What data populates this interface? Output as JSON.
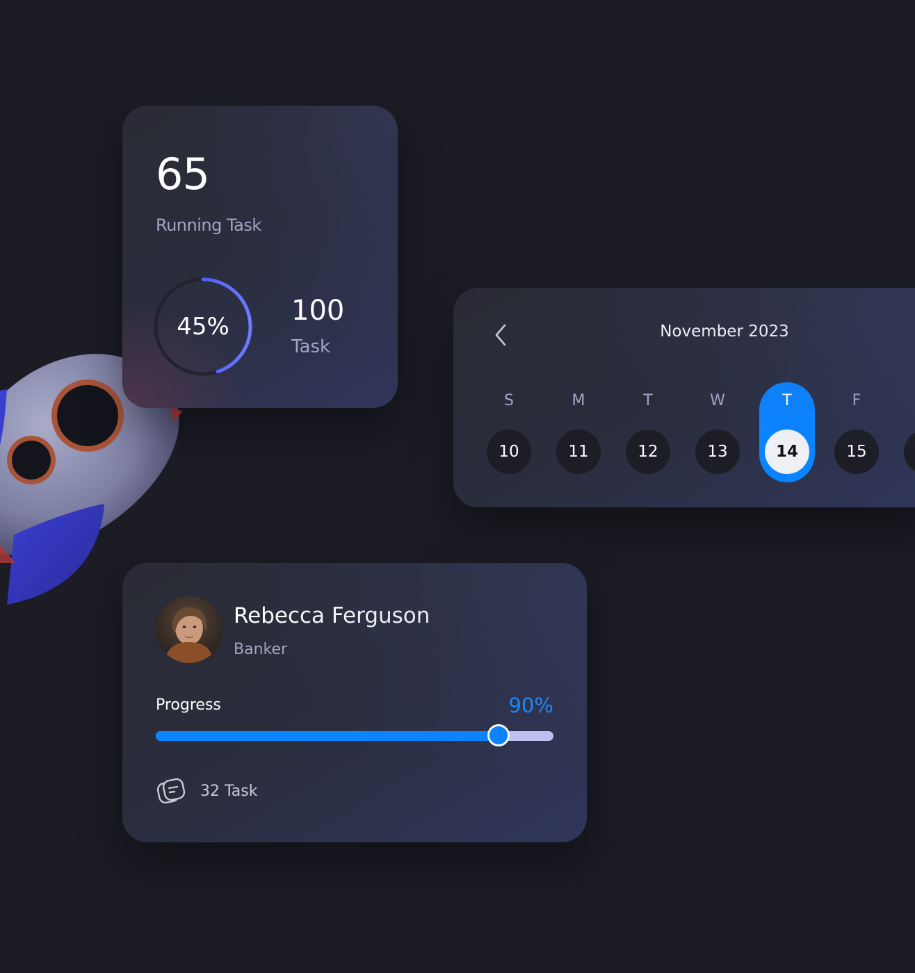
{
  "running_card": {
    "count": "65",
    "label": "Running Task",
    "percent_text": "45%",
    "percent_value": 45,
    "total": "100",
    "total_label": "Task"
  },
  "calendar": {
    "title": "November 2023",
    "days": [
      {
        "letter": "S",
        "number": "10",
        "selected": false
      },
      {
        "letter": "M",
        "number": "11",
        "selected": false
      },
      {
        "letter": "T",
        "number": "12",
        "selected": false
      },
      {
        "letter": "W",
        "number": "13",
        "selected": false
      },
      {
        "letter": "T",
        "number": "14",
        "selected": true
      },
      {
        "letter": "F",
        "number": "15",
        "selected": false
      }
    ]
  },
  "profile_card": {
    "name": "Rebecca Ferguson",
    "role": "Banker",
    "progress_label": "Progress",
    "progress_text": "90%",
    "progress_value": 0.86,
    "task_count": "32 Task"
  },
  "icons": {
    "calendar_prev": "chevron-left-icon",
    "task": "task-note-icon"
  },
  "colors": {
    "background": "#1b1c24",
    "accent_blue": "#0a84ff",
    "ring_gradient_start": "#3b3ff2",
    "ring_gradient_end": "#6b7cff",
    "muted_text": "#a3a6c6"
  }
}
